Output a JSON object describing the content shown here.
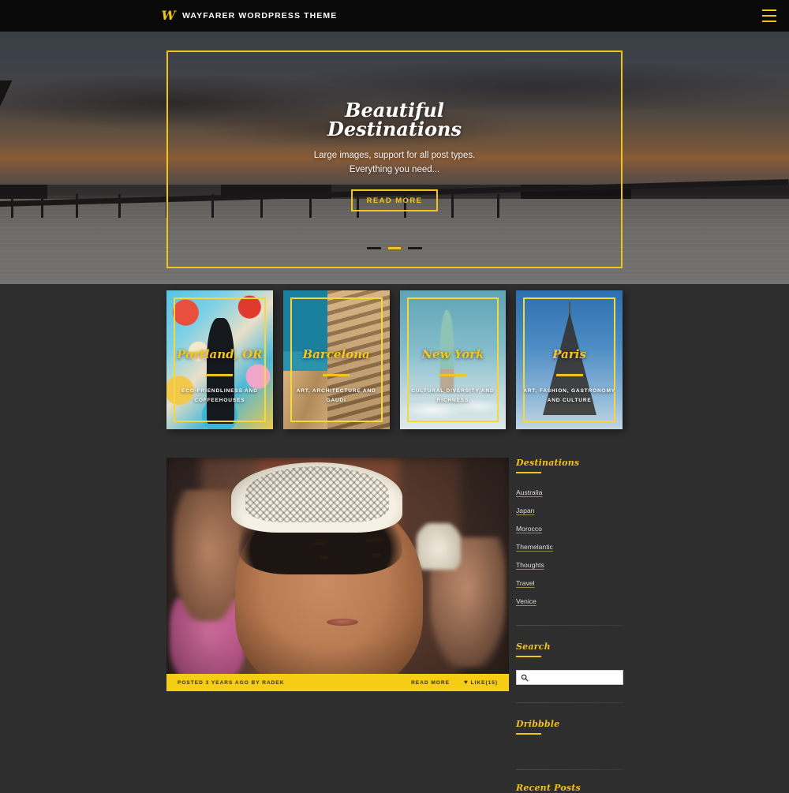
{
  "header": {
    "logo_letter": "W",
    "brand": "WAYFARER WORDPRESS THEME",
    "menu_icon": "hamburger-icon"
  },
  "hero": {
    "title_line1": "Beautiful",
    "title_line2": "Destinations",
    "subtitle_line1": "Large images, support for all post types.",
    "subtitle_line2": "Everything you need...",
    "button": "READ MORE",
    "slides_total": 3,
    "active_slide": 2
  },
  "cards": [
    {
      "title": "Portland, OR",
      "desc": "ECO-FRIENDLINESS AND COFFEEHOUSES",
      "art": "art-portland"
    },
    {
      "title": "Barcelona",
      "desc": "ART, ARCHITECTURE AND GAUDI",
      "art": "art-barcelona"
    },
    {
      "title": "New York",
      "desc": "CULTURAL DIVERSITY AND RICHNESS",
      "art": "art-newyork"
    },
    {
      "title": "Paris",
      "desc": "ART, FASHION, GASTRONOMY AND CULTURE",
      "art": "art-paris"
    }
  ],
  "post": {
    "meta_posted": "POSTED 3 YEARS AGO BY RADEK",
    "read_more": "READ MORE",
    "like_label": "LIKE(15)",
    "heart_glyph": "♥"
  },
  "sidebar": {
    "destinations": {
      "title": "Destinations",
      "items": [
        "Australia",
        "Japan",
        "Morocco",
        "Themelantic",
        "Thoughts",
        "Travel",
        "Venice"
      ]
    },
    "search": {
      "title": "Search",
      "value": "",
      "placeholder": "",
      "icon": "search-icon"
    },
    "dribbble": {
      "title": "Dribbble"
    },
    "recent": {
      "title": "Recent Posts"
    }
  },
  "colors": {
    "accent": "#f0c419",
    "page_bg": "#2e2e2e",
    "header_bg": "#0a0a0a",
    "meta_bar": "#f5cd14"
  }
}
